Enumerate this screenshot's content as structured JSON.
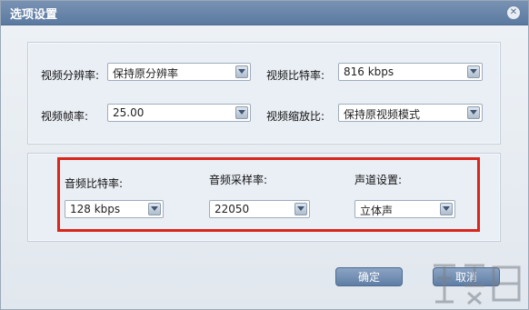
{
  "dialog": {
    "title": "选项设置"
  },
  "video": {
    "resolution": {
      "label": "视频分辨率:",
      "value": "保持原分辨率"
    },
    "bitrate": {
      "label": "视频比特率:",
      "value": "816 kbps"
    },
    "framerate": {
      "label": "视频帧率:",
      "value": "25.00"
    },
    "scaling": {
      "label": "视频缩放比:",
      "value": "保持原视频模式"
    }
  },
  "audio": {
    "bitrate": {
      "label": "音频比特率:",
      "value": "128 kbps"
    },
    "samplerate": {
      "label": "音频采样率:",
      "value": "22050"
    },
    "channel": {
      "label": "声道设置:",
      "value": "立体声"
    }
  },
  "buttons": {
    "ok": "确定",
    "cancel": "取消"
  },
  "colors": {
    "highlight": "#d9261c",
    "titlebar": "#6883a8",
    "button": "#7590b5"
  }
}
